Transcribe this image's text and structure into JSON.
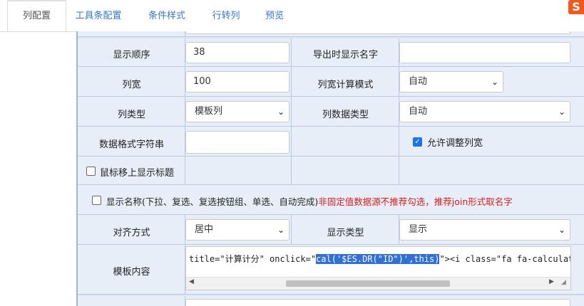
{
  "tabs": [
    {
      "label": "列配置",
      "active": true
    },
    {
      "label": "工具条配置",
      "active": false
    },
    {
      "label": "条件样式",
      "active": false
    },
    {
      "label": "行转列",
      "active": false
    },
    {
      "label": "预览",
      "active": false
    }
  ],
  "logo": {
    "glyph": "S",
    "color": "#f0581d"
  },
  "form": {
    "display_order": {
      "label": "显示顺序",
      "value": "38"
    },
    "export_name": {
      "label": "导出时显示名字",
      "value": ""
    },
    "col_width": {
      "label": "列宽",
      "value": "100"
    },
    "width_mode": {
      "label": "列宽计算模式",
      "value": "自动"
    },
    "col_type": {
      "label": "列类型",
      "value": "模板列"
    },
    "data_type": {
      "label": "列数据类型",
      "value": "自动"
    },
    "format_string": {
      "label": "数据格式字符串",
      "value": ""
    },
    "allow_resize": {
      "label": "允许调整列宽",
      "checked": true
    },
    "hover_title": {
      "label": "鼠标移上显示标题",
      "checked": false
    },
    "show_name": {
      "label": "显示名称(下拉、复选、复选按钮组、单选、自动完成)",
      "warning": "非固定值数据源不推荐勾选，推荐join形式取名字",
      "checked": false
    },
    "align": {
      "label": "对齐方式",
      "value": "居中"
    },
    "display_type": {
      "label": "显示类型",
      "value": "显示"
    },
    "template": {
      "label": "模板内容",
      "code_before": "title=\"计算计分\" onclick=\"",
      "code_selected": "cal('$ES.DR(\"ID\")',this)",
      "code_after": "\"><i class=\"fa fa-calculator"
    }
  },
  "colors": {
    "accent": "#1a73e8",
    "tab_link": "#3a77c9",
    "warning": "#d41e1e"
  }
}
